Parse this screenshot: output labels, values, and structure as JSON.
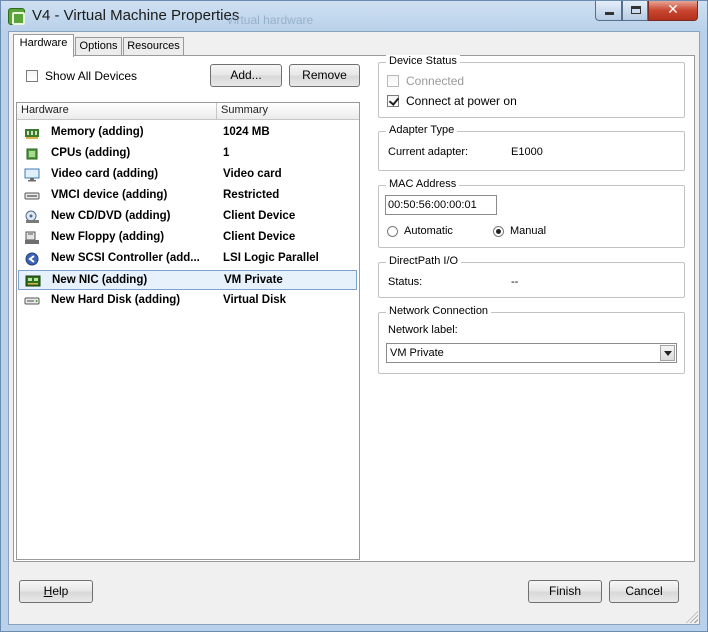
{
  "window": {
    "title": "V4 - Virtual Machine Properties",
    "ghost_title": "Virtual hardware",
    "close_glyph": "✕"
  },
  "tabs": [
    {
      "label": "Hardware",
      "active": true
    },
    {
      "label": "Options",
      "active": false
    },
    {
      "label": "Resources",
      "active": false
    }
  ],
  "toolbar": {
    "show_all_devices": "Show All Devices",
    "show_all_checked": false,
    "add_label": "Add...",
    "remove_label": "Remove"
  },
  "hardware_list": {
    "columns": [
      "Hardware",
      "Summary"
    ],
    "rows": [
      {
        "name": "Memory (adding)",
        "summary": "1024 MB",
        "icon": "memory-icon"
      },
      {
        "name": "CPUs (adding)",
        "summary": "1",
        "icon": "cpu-icon"
      },
      {
        "name": "Video card  (adding)",
        "summary": "Video card",
        "icon": "monitor-icon"
      },
      {
        "name": "VMCI device (adding)",
        "summary": "Restricted",
        "icon": "vmci-device-icon"
      },
      {
        "name": "New CD/DVD (adding)",
        "summary": "Client Device",
        "icon": "cd-dvd-icon"
      },
      {
        "name": "New Floppy (adding)",
        "summary": "Client Device",
        "icon": "floppy-icon"
      },
      {
        "name": "New SCSI Controller (add...",
        "summary": "LSI Logic Parallel",
        "icon": "scsi-controller-icon"
      },
      {
        "name": "New NIC (adding)",
        "summary": "VM Private",
        "icon": "network-card-icon",
        "selected": true
      },
      {
        "name": "New Hard Disk (adding)",
        "summary": "Virtual Disk",
        "icon": "hard-disk-icon"
      }
    ]
  },
  "device_status": {
    "legend": "Device Status",
    "connected_label": "Connected",
    "connected_checked": false,
    "connected_disabled": true,
    "power_on_label": "Connect at power on",
    "power_on_checked": true
  },
  "adapter_type": {
    "legend": "Adapter Type",
    "label": "Current adapter:",
    "value": "E1000"
  },
  "mac_address": {
    "legend": "MAC Address",
    "value": "00:50:56:00:00:01",
    "automatic_label": "Automatic",
    "manual_label": "Manual",
    "selected": "Manual"
  },
  "directpath": {
    "legend": "DirectPath I/O",
    "status_label": "Status:",
    "status_value": "--"
  },
  "network_connection": {
    "legend": "Network Connection",
    "label": "Network label:",
    "selected": "VM Private"
  },
  "footer": {
    "help_label": "Help",
    "finish_label": "Finish",
    "cancel_label": "Cancel"
  },
  "colors": {
    "title_bg": "#b9d1ea",
    "selection_bg": "#e7f1fb",
    "selection_border": "#7da2ce",
    "close_button": "#c8452f"
  }
}
